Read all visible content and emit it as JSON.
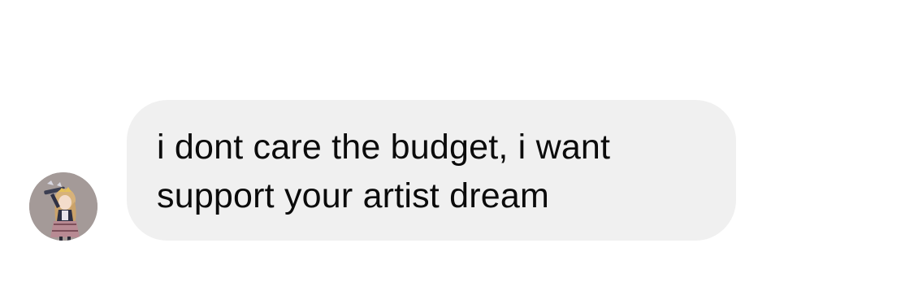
{
  "message": {
    "lines": [
      "i dont care the budget, i want",
      "support your artist dream"
    ],
    "bubble_color": "#f0f0f0",
    "text_color": "#0b0b0b"
  },
  "avatar": {
    "icon": "anime-character-avatar"
  }
}
